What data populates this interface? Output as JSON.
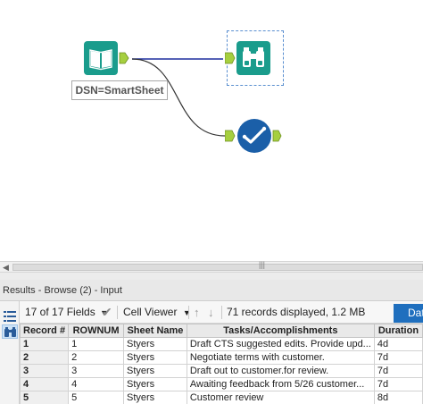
{
  "canvas": {
    "input_tool_caption": "DSN=SmartSheet"
  },
  "results": {
    "title": "Results - Browse (2) - Input",
    "toolbar": {
      "fields_label": "17 of 17 Fields",
      "cell_viewer_label": "Cell Viewer",
      "records_status": "71 records displayed, 1.2 MB",
      "data_button_label": "Data"
    },
    "table": {
      "headers": [
        "Record #",
        "ROWNUM",
        "Sheet Name",
        "Tasks/Accomplishments",
        "Duration"
      ],
      "rows": [
        {
          "record": "1",
          "rownum": "1",
          "sheet": "Styers",
          "task": "Draft CTS suggested edits. Provide upd...",
          "duration": "4d"
        },
        {
          "record": "2",
          "rownum": "2",
          "sheet": "Styers",
          "task": "Negotiate terms with customer.",
          "duration": "7d"
        },
        {
          "record": "3",
          "rownum": "3",
          "sheet": "Styers",
          "task": "Draft out to customer.for review.",
          "duration": "7d"
        },
        {
          "record": "4",
          "rownum": "4",
          "sheet": "Styers",
          "task": "Awaiting feedback from 5/26 customer...",
          "duration": "7d"
        },
        {
          "record": "5",
          "rownum": "5",
          "sheet": "Styers",
          "task": "Customer review",
          "duration": "8d"
        }
      ]
    }
  },
  "icons": {
    "input_tool": "book-icon",
    "browse_tool": "binoculars-icon",
    "output_tool": "check-circle-icon",
    "fields_menu": "checkmark-icon",
    "sort_up": "arrow-up-icon",
    "sort_down": "arrow-down-icon",
    "side_list": "list-icon",
    "side_browse": "binoculars-icon"
  },
  "colors": {
    "input_tool": "#1a9c8c",
    "browse_tool": "#1a9c8c",
    "output_tool": "#1b5fa8",
    "connection_selected": "#1f2f9e",
    "connection": "#333333",
    "anchor": "#a6cf3f",
    "data_button": "#1f6fbe"
  }
}
